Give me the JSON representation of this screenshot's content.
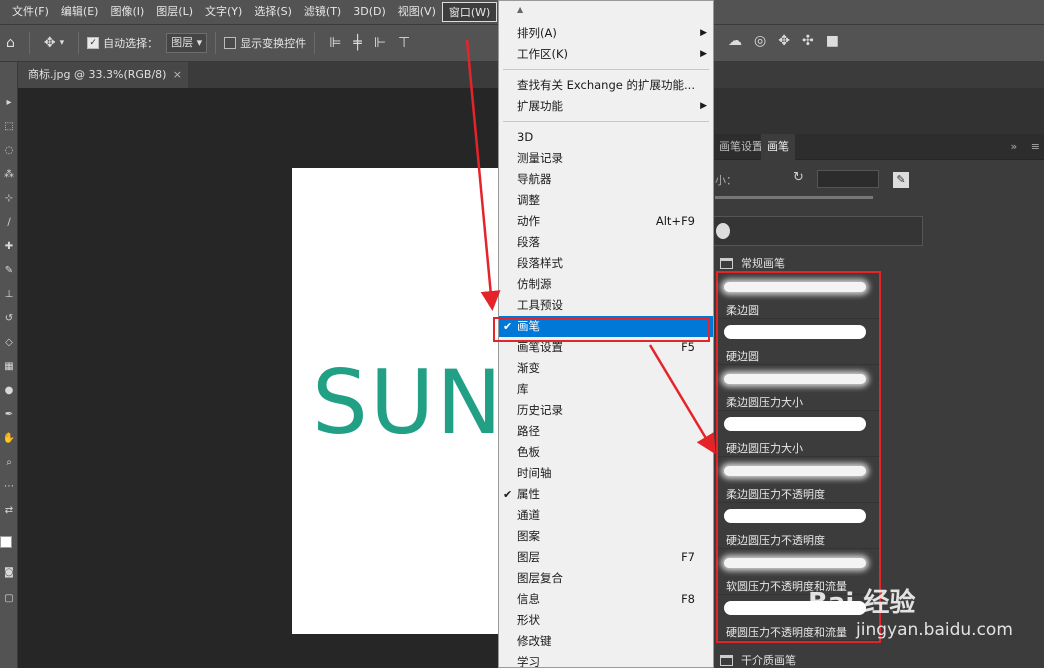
{
  "menubar": {
    "items": [
      "文件(F)",
      "编辑(E)",
      "图像(I)",
      "图层(L)",
      "文字(Y)",
      "选择(S)",
      "滤镜(T)",
      "3D(D)",
      "视图(V)",
      "窗口(W)"
    ]
  },
  "options": {
    "auto_select_label": "自动选择：",
    "layer_select": "图层",
    "show_transform_label": "显示变换控件"
  },
  "document": {
    "tab_title": "商标.jpg @ 33.3%(RGB/8)",
    "close": "×",
    "canvas_text": "SUN"
  },
  "window_menu": {
    "top_arrow": "▲",
    "items": [
      {
        "label": "排列(A)",
        "shortcut": "",
        "submenu": true,
        "checked": false
      },
      {
        "label": "工作区(K)",
        "shortcut": "",
        "submenu": true,
        "checked": false
      },
      {
        "label": "查找有关 Exchange 的扩展功能...",
        "shortcut": "",
        "submenu": false,
        "checked": false
      },
      {
        "label": "扩展功能",
        "shortcut": "",
        "submenu": true,
        "checked": false
      },
      {
        "label": "3D",
        "shortcut": "",
        "submenu": false,
        "checked": false
      },
      {
        "label": "测量记录",
        "shortcut": "",
        "submenu": false,
        "checked": false
      },
      {
        "label": "导航器",
        "shortcut": "",
        "submenu": false,
        "checked": false
      },
      {
        "label": "调整",
        "shortcut": "",
        "submenu": false,
        "checked": false
      },
      {
        "label": "动作",
        "shortcut": "Alt+F9",
        "submenu": false,
        "checked": false
      },
      {
        "label": "段落",
        "shortcut": "",
        "submenu": false,
        "checked": false
      },
      {
        "label": "段落样式",
        "shortcut": "",
        "submenu": false,
        "checked": false
      },
      {
        "label": "仿制源",
        "shortcut": "",
        "submenu": false,
        "checked": false
      },
      {
        "label": "工具预设",
        "shortcut": "",
        "submenu": false,
        "checked": false
      },
      {
        "label": "画笔",
        "shortcut": "",
        "submenu": false,
        "checked": true,
        "highlighted": true
      },
      {
        "label": "画笔设置",
        "shortcut": "F5",
        "submenu": false,
        "checked": false
      },
      {
        "label": "渐变",
        "shortcut": "",
        "submenu": false,
        "checked": false
      },
      {
        "label": "库",
        "shortcut": "",
        "submenu": false,
        "checked": false
      },
      {
        "label": "历史记录",
        "shortcut": "",
        "submenu": false,
        "checked": false
      },
      {
        "label": "路径",
        "shortcut": "",
        "submenu": false,
        "checked": false
      },
      {
        "label": "色板",
        "shortcut": "",
        "submenu": false,
        "checked": false
      },
      {
        "label": "时间轴",
        "shortcut": "",
        "submenu": false,
        "checked": false
      },
      {
        "label": "属性",
        "shortcut": "",
        "submenu": false,
        "checked": true
      },
      {
        "label": "通道",
        "shortcut": "",
        "submenu": false,
        "checked": false
      },
      {
        "label": "图案",
        "shortcut": "",
        "submenu": false,
        "checked": false
      },
      {
        "label": "图层",
        "shortcut": "F7",
        "submenu": false,
        "checked": false
      },
      {
        "label": "图层复合",
        "shortcut": "",
        "submenu": false,
        "checked": false
      },
      {
        "label": "信息",
        "shortcut": "F8",
        "submenu": false,
        "checked": false
      },
      {
        "label": "形状",
        "shortcut": "",
        "submenu": false,
        "checked": false
      },
      {
        "label": "修改键",
        "shortcut": "",
        "submenu": false,
        "checked": false
      },
      {
        "label": "学习",
        "shortcut": "",
        "submenu": false,
        "checked": false
      }
    ]
  },
  "brush_panel": {
    "tabs": [
      "画笔设置",
      "画笔"
    ],
    "active_tab": "画笔",
    "size_label": "小：",
    "collapse": "»",
    "menu": "≡",
    "group_general": "常规画笔",
    "group_dry": "干介质画笔",
    "brushes": [
      "柔边圆",
      "硬边圆",
      "柔边圆压力大小",
      "硬边圆压力大小",
      "柔边圆压力不透明度",
      "硬边圆压力不透明度",
      "软圆压力不透明度和流量",
      "硬圆压力不透明度和流量"
    ]
  },
  "watermark": {
    "brand": "Bai 经验",
    "url": "jingyan.baidu.com"
  },
  "colors": {
    "accent": "#e5242a",
    "highlight": "#0078d7",
    "logo_text": "#22a085"
  }
}
